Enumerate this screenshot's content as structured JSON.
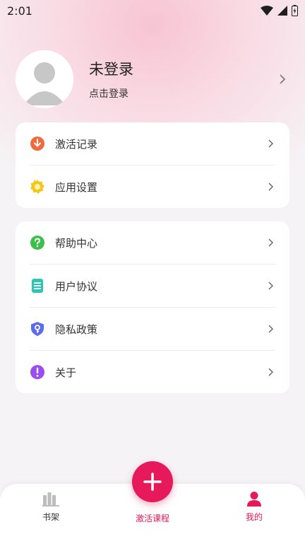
{
  "status_bar": {
    "time": "2:01",
    "icons": [
      "wifi-icon",
      "signal-icon",
      "battery-icon"
    ]
  },
  "profile": {
    "name": "未登录",
    "hint": "点击登录"
  },
  "menu_group_1": [
    {
      "label": "激活记录",
      "icon": "download-icon",
      "color": "#f06a3b"
    },
    {
      "label": "应用设置",
      "icon": "gear-icon",
      "color": "#f5c518"
    }
  ],
  "menu_group_2": [
    {
      "label": "帮助中心",
      "icon": "help-icon",
      "color": "#3cc04a"
    },
    {
      "label": "用户协议",
      "icon": "document-icon",
      "color": "#2ec4b6"
    },
    {
      "label": "隐私政策",
      "icon": "shield-icon",
      "color": "#5b6cf0"
    },
    {
      "label": "关于",
      "icon": "info-icon",
      "color": "#9b4df0"
    }
  ],
  "tabbar": {
    "bookshelf": "书架",
    "activate": "激活课程",
    "mine": "我的",
    "active_color": "#e6195a",
    "inactive_color": "#333333"
  }
}
